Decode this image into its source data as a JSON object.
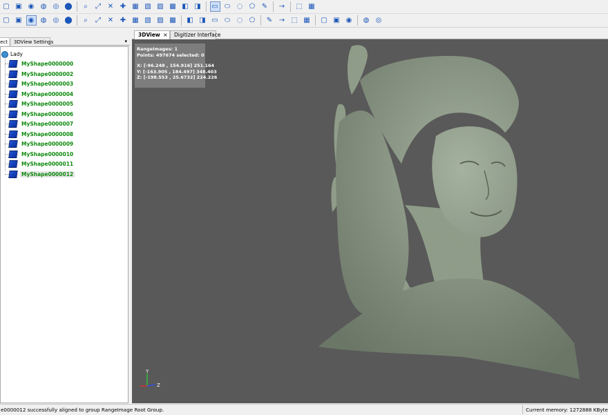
{
  "toolbar_row1_icons": [
    "new-icon",
    "open-icon",
    "close-icon",
    "save-icon",
    "export-icon",
    "stop-icon",
    "zoom-icon",
    "fit-view-icon",
    "align-icon",
    "select-icon",
    "cube-front-icon",
    "cube-back-icon",
    "cube-left-icon",
    "cube-right-icon",
    "cube-top-icon",
    "cube-iso-icon",
    "rectangle-select-icon",
    "ellipse-select-icon",
    "lasso-icon",
    "polygon-select-icon",
    "pen-icon",
    "arrow-icon",
    "mesh-icon",
    "grid-icon"
  ],
  "toolbar_row2_icons": [
    "filter-icon",
    "sphere-icon",
    "gear-icon",
    "camera-icon",
    "light-icon",
    "render-icon",
    "move-icon",
    "scale-icon",
    "points-icon",
    "mesh-color-icon",
    "mesh-solid-icon",
    "mesh-wire-icon",
    "cut-icon",
    "cursor-icon",
    "hand-icon",
    "vertex-icon",
    "edge-icon",
    "face-icon",
    "fill-icon",
    "smooth-icon",
    "decimate-icon",
    "merge-icon",
    "register-icon",
    "scan-icon",
    "probe-icon",
    "measure-icon",
    "dots-icon",
    "cloud-icon",
    "compare-icon"
  ],
  "left_panel": {
    "tabs": [
      {
        "label": "ect"
      },
      {
        "label": "3DView Settings"
      }
    ],
    "root": {
      "label": "Lady",
      "icon": "gear-icon"
    },
    "items": [
      {
        "label": "MyShape0000000"
      },
      {
        "label": "MyShape0000002"
      },
      {
        "label": "MyShape0000003"
      },
      {
        "label": "MyShape0000004"
      },
      {
        "label": "MyShape0000005"
      },
      {
        "label": "MyShape0000006"
      },
      {
        "label": "MyShape0000007"
      },
      {
        "label": "MyShape0000008"
      },
      {
        "label": "MyShape0000009"
      },
      {
        "label": "MyShape0000010"
      },
      {
        "label": "MyShape0000011"
      },
      {
        "label": "MyShape0000012"
      }
    ]
  },
  "view_tabs": [
    {
      "label": "3DView",
      "close": "×"
    },
    {
      "label": "Digitizer Interface"
    }
  ],
  "info_overlay": {
    "line1": "RangeImages: 1",
    "line2": "Points: 497674  selected: 0",
    "x": "X: [-96.248 , 154.916] 251.164",
    "y": "Y: [-163.905 , 184.497] 348.403",
    "z": "Z: [-198.553 , 25.6732] 224.226"
  },
  "axes": {
    "y": "Y",
    "z": "Z"
  },
  "status": {
    "message": "e0000012 successfully aligned to group RangeImage Root Group.",
    "memory": "Current memory: 1272888 KByte"
  },
  "colors": {
    "viewport": "#595959",
    "model": "#8c9a86",
    "tree_label": "#0f8a0f"
  }
}
